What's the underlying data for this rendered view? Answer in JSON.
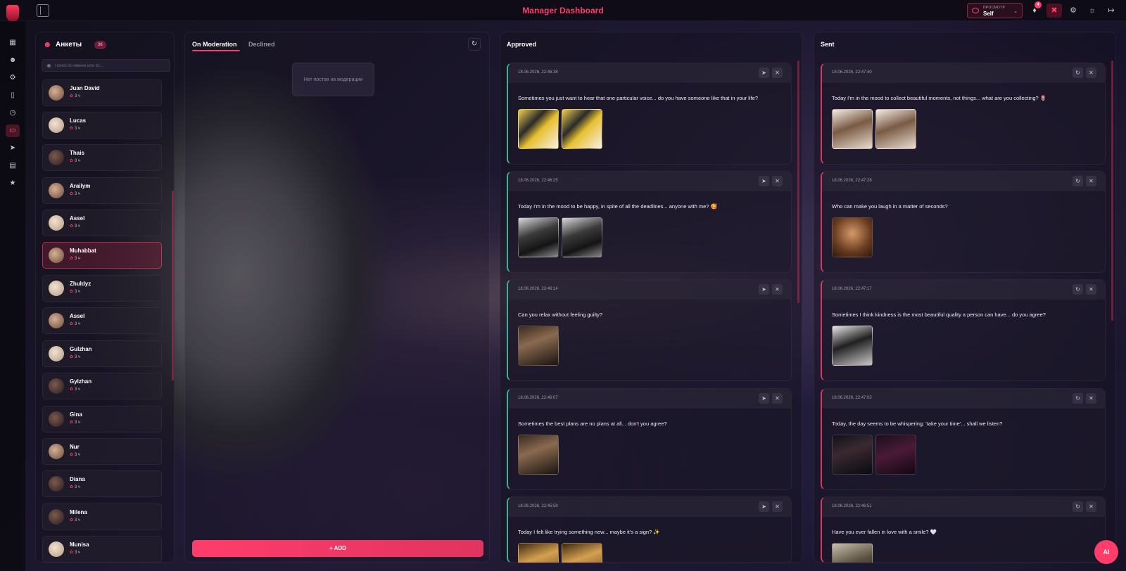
{
  "app": {
    "title": "Manager Dashboard"
  },
  "header": {
    "view_label": "ПРОСМОТР",
    "view_value": "Self",
    "notifications_count": "4"
  },
  "profiles": {
    "title": "Анкеты",
    "count": "36",
    "search_placeholder": "Поиск по имени или ID...",
    "items": [
      {
        "name": "Juan David",
        "time": "3 ч"
      },
      {
        "name": "Lucas",
        "time": "3 ч"
      },
      {
        "name": "Thais",
        "time": "3 ч"
      },
      {
        "name": "Arailym",
        "time": "3 ч"
      },
      {
        "name": "Assel",
        "time": "3 ч"
      },
      {
        "name": "Muhabbat",
        "time": "3 ч"
      },
      {
        "name": "Zhuldyz",
        "time": "3 ч"
      },
      {
        "name": "Assel",
        "time": "3 ч"
      },
      {
        "name": "Gulzhan",
        "time": "3 ч"
      },
      {
        "name": "Gylzhan",
        "time": "3 ч"
      },
      {
        "name": "Gina",
        "time": "3 ч"
      },
      {
        "name": "Nur",
        "time": "3 ч"
      },
      {
        "name": "Diana",
        "time": "3 ч"
      },
      {
        "name": "Milena",
        "time": "3 ч"
      },
      {
        "name": "Munisa",
        "time": "3 ч"
      }
    ]
  },
  "moderation": {
    "tabs": [
      "On Moderation",
      "Declined"
    ],
    "empty_message": "Нет постов на модерации",
    "add_label": "ADD"
  },
  "approved": {
    "title": "Approved",
    "posts": [
      {
        "date": "18.06.2026, 22:46:38",
        "text": "Sometimes you just want to hear that one particular voice... do you have someone like that in your life?"
      },
      {
        "date": "18.06.2026, 22:46:25",
        "text": "Today I'm in the mood to be happy, in spite of all the deadlines... anyone with me? 🥰"
      },
      {
        "date": "18.06.2026, 22:46:14",
        "text": "Can you relax without feeling guilty?"
      },
      {
        "date": "18.06.2026, 22:46:07",
        "text": "Sometimes the best plans are no plans at all... don't you agree?"
      },
      {
        "date": "18.06.2026, 22:45:59",
        "text": "Today I felt like trying something new... maybe it's a sign? ✨"
      }
    ]
  },
  "sent": {
    "title": "Sent",
    "posts": [
      {
        "date": "18.06.2026, 22:47:40",
        "text": "Today I'm in the mood to collect beautiful moments, not things... what are you collecting? 🌷"
      },
      {
        "date": "18.06.2026, 22:47:28",
        "text": "Who can make you laugh in a matter of seconds?"
      },
      {
        "date": "18.06.2026, 22:47:17",
        "text": "Sometimes I think kindness is the most beautiful quality a person can have... do you agree?"
      },
      {
        "date": "18.06.2026, 22:47:03",
        "text": "Today, the day seems to be whispering: 'take your time'... shall we listen?"
      },
      {
        "date": "18.06.2026, 22:46:51",
        "text": "Have you ever fallen in love with a smile? 🤍"
      }
    ]
  },
  "ai_button": "AI",
  "colors": {
    "accent": "#ff3d6b",
    "approved": "#2fb89a",
    "sent": "#e0345e"
  }
}
